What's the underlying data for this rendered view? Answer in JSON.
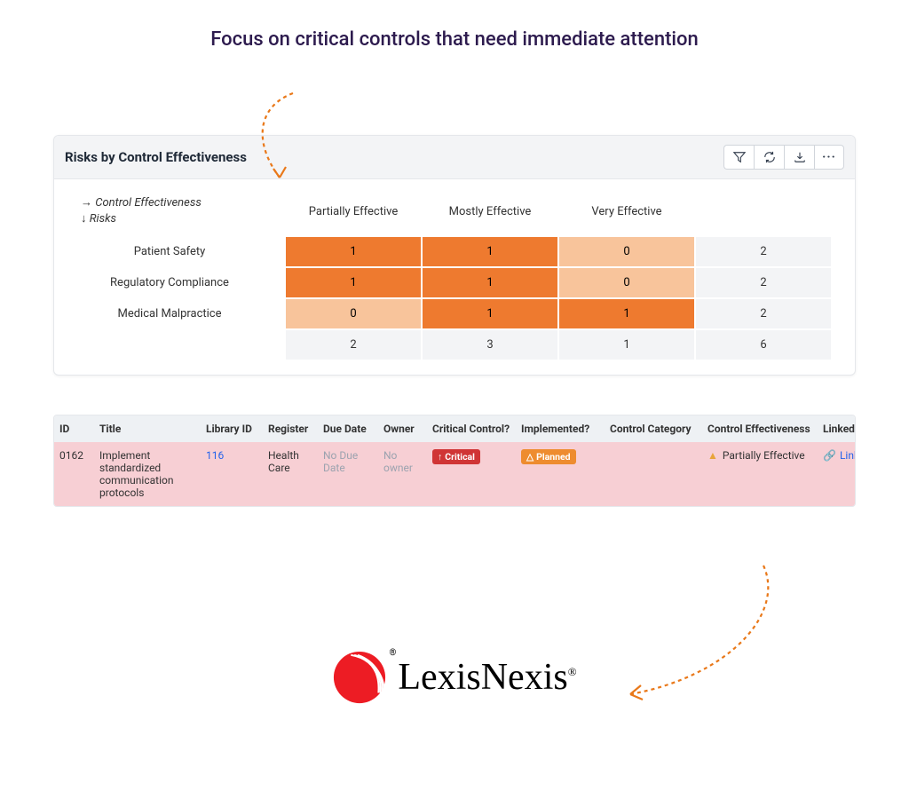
{
  "headline": "Focus on critical controls that need immediate attention",
  "card": {
    "title": "Risks by Control Effectiveness"
  },
  "axis": {
    "col_label": "Control Effectiveness",
    "row_label": "Risks"
  },
  "matrix": {
    "columns": [
      "Partially Effective",
      "Mostly Effective",
      "Very Effective",
      ""
    ],
    "rows": [
      {
        "label": "Patient Safety",
        "cells": [
          "1",
          "1",
          "0",
          "2"
        ],
        "tones": [
          "dark",
          "dark",
          "light",
          "total"
        ]
      },
      {
        "label": "Regulatory Compliance",
        "cells": [
          "1",
          "1",
          "0",
          "2"
        ],
        "tones": [
          "dark",
          "dark",
          "light",
          "total"
        ]
      },
      {
        "label": "Medical Malpractice",
        "cells": [
          "0",
          "1",
          "1",
          "2"
        ],
        "tones": [
          "light",
          "dark",
          "dark",
          "total"
        ]
      },
      {
        "label": "",
        "cells": [
          "2",
          "3",
          "1",
          "6"
        ],
        "tones": [
          "total",
          "total",
          "total",
          "total"
        ]
      }
    ]
  },
  "table": {
    "headers": [
      "ID",
      "Title",
      "Library ID",
      "Register",
      "Due Date",
      "Owner",
      "Critical Control?",
      "Implemented?",
      "Control Category",
      "Control Effectiveness",
      "Linked to"
    ],
    "row": {
      "id": "0162",
      "title": "Implement standardized communication protocols",
      "library_id": "116",
      "register": "Health Care",
      "due_date": "No Due Date",
      "owner": "No owner",
      "critical_badge": "Critical",
      "implemented_badge": "Planned",
      "category": "",
      "effectiveness": "Partially Effective",
      "linked_to": "Link"
    }
  },
  "logo": {
    "brand": "LexisNexis"
  }
}
